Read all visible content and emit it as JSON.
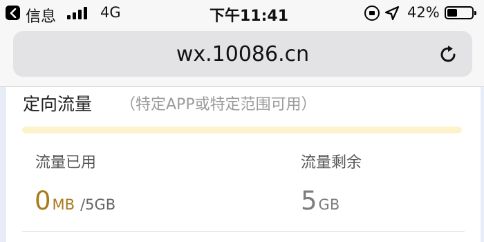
{
  "status_bar": {
    "back_app": "信息",
    "network": "4G",
    "time": "下午11:41",
    "battery_percent": "42%",
    "battery_level": 0.42
  },
  "browser": {
    "url": "wx.10086.cn"
  },
  "card": {
    "title": "定向流量",
    "subtitle": "（特定APP或特定范围可用）",
    "usage_fraction": 0,
    "used": {
      "label": "流量已用",
      "value": "0",
      "unit": "MB",
      "total": "/5GB"
    },
    "remaining": {
      "label": "流量剩余",
      "value": "5",
      "unit": "GB"
    }
  },
  "colors": {
    "accent": "#a87b1c",
    "progress_track": "#fcf3cc",
    "url_bar": "#e3e3e5",
    "page_bg": "#e7ecf7"
  }
}
